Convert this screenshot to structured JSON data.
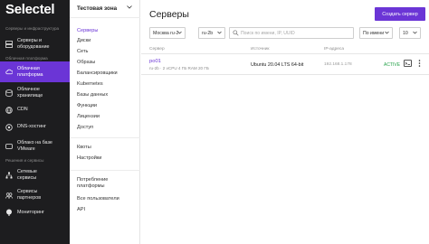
{
  "app": {
    "logo": "Selectel"
  },
  "sidebar": {
    "section_infra": "Серверы и инфраструктура",
    "section_cloud": "Облачная платформа",
    "section_services": "Решения и сервисы",
    "items": [
      {
        "label": "Серверы и\nоборудование",
        "icon": "server-icon"
      },
      {
        "label": "Облачная\nплатформа",
        "icon": "cloud-icon"
      },
      {
        "label": "Облачное\nхранилище",
        "icon": "storage-icon"
      },
      {
        "label": "CDN",
        "icon": "cdn-icon"
      },
      {
        "label": "DNS-хостинг",
        "icon": "dns-icon"
      },
      {
        "label": "Облако на базе\nVMware",
        "icon": "vmware-icon"
      },
      {
        "label": "Сетевые\nсервисы",
        "icon": "network-icon"
      },
      {
        "label": "Сервисы\nпартнеров",
        "icon": "partners-icon"
      },
      {
        "label": "Мониторинг",
        "icon": "monitoring-icon"
      }
    ],
    "accent_color": "#6b35d6"
  },
  "zone_panel": {
    "zone_name": "Тестовая зона",
    "items": [
      "Серверы",
      "Диски",
      "Сеть",
      "Образы",
      "Балансировщики",
      "Kubernetes",
      "Базы данных",
      "Функции",
      "Лицензии",
      "Доступ",
      "Квоты",
      "Настройки",
      "Потребление\nплатформы",
      "Все пользователи",
      "API"
    ]
  },
  "main": {
    "title": "Серверы",
    "create_button": "Создать сервер",
    "filters": {
      "region": "Москва ru-2",
      "pool": "ru-2b",
      "search_placeholder": "Поиск по имени, IP, UUID",
      "sort": "По имени",
      "per_page": "10"
    },
    "columns": [
      "Сервер",
      "Источник",
      "IP-адреса"
    ],
    "rows": [
      {
        "name": "po01",
        "meta": "ru-2b  ·  2 vCPU  4 ГБ RAM  20 ГБ",
        "source": "Ubuntu 20.04 LTS 64-bit",
        "ip": "192.168.1.178",
        "status": "ACTIVE"
      }
    ]
  }
}
